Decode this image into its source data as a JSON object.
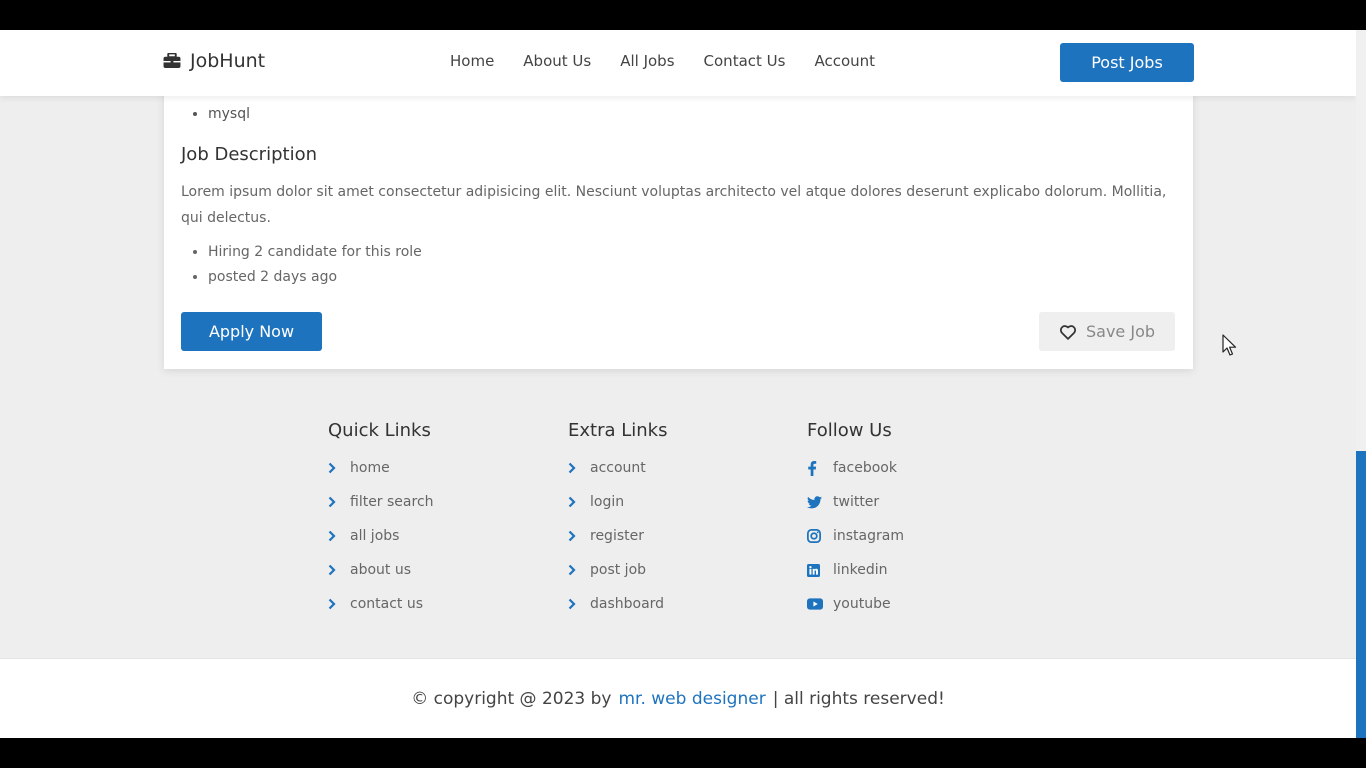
{
  "header": {
    "brand": "JobHunt",
    "nav": [
      "Home",
      "About Us",
      "All Jobs",
      "Contact Us",
      "Account"
    ],
    "post_jobs": "Post Jobs"
  },
  "job": {
    "skills": [
      "mysql"
    ],
    "description_title": "Job Description",
    "description": "Lorem ipsum dolor sit amet consectetur adipisicing elit. Nesciunt voluptas architecto vel atque dolores deserunt explicabo dolorum. Mollitia, qui delectus.",
    "meta": [
      "Hiring 2 candidate for this role",
      "posted 2 days ago"
    ],
    "apply_label": "Apply Now",
    "save_label": "Save Job"
  },
  "footer": {
    "quick_links": {
      "title": "Quick Links",
      "items": [
        "home",
        "filter search",
        "all jobs",
        "about us",
        "contact us"
      ]
    },
    "extra_links": {
      "title": "Extra Links",
      "items": [
        "account",
        "login",
        "register",
        "post job",
        "dashboard"
      ]
    },
    "follow_us": {
      "title": "Follow Us",
      "items": [
        {
          "label": "facebook",
          "icon": "facebook-icon"
        },
        {
          "label": "twitter",
          "icon": "twitter-icon"
        },
        {
          "label": "instagram",
          "icon": "instagram-icon"
        },
        {
          "label": "linkedin",
          "icon": "linkedin-icon"
        },
        {
          "label": "youtube",
          "icon": "youtube-icon"
        }
      ]
    },
    "credit_prefix": "© copyright @ 2023 by",
    "credit_author": "mr. web designer",
    "credit_suffix": "| all rights reserved!"
  },
  "colors": {
    "accent": "#1e73be",
    "background": "#eeeeee"
  }
}
